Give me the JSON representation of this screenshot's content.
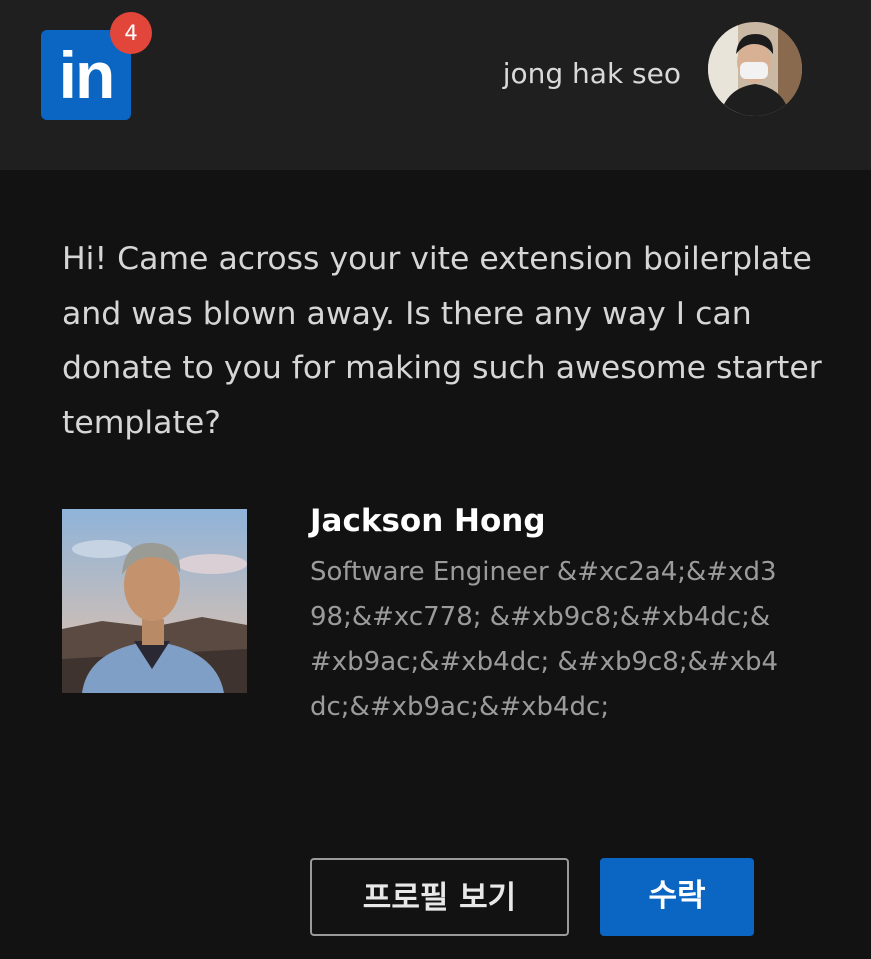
{
  "header": {
    "logo_text": "in",
    "notification_count": "4",
    "user_name": "jong hak seo",
    "brand_color": "#0a66c2",
    "badge_color": "#e2463b"
  },
  "message": {
    "text": "Hi! Came across your vite extension boilerplate and was blown away. Is there any way I can donate to you for making such awesome starter template?"
  },
  "invitation": {
    "name": "Jackson Hong",
    "headline": "Software Engineer &#xc2a4;&#xd398;&#xc778; &#xb9c8;&#xb4dc;&#xb9ac;&#xb4dc; &#xb9c8;&#xb4dc;&#xb9ac;&#xb4dc;"
  },
  "actions": {
    "view_profile_label": "프로필 보기",
    "accept_label": "수락"
  }
}
